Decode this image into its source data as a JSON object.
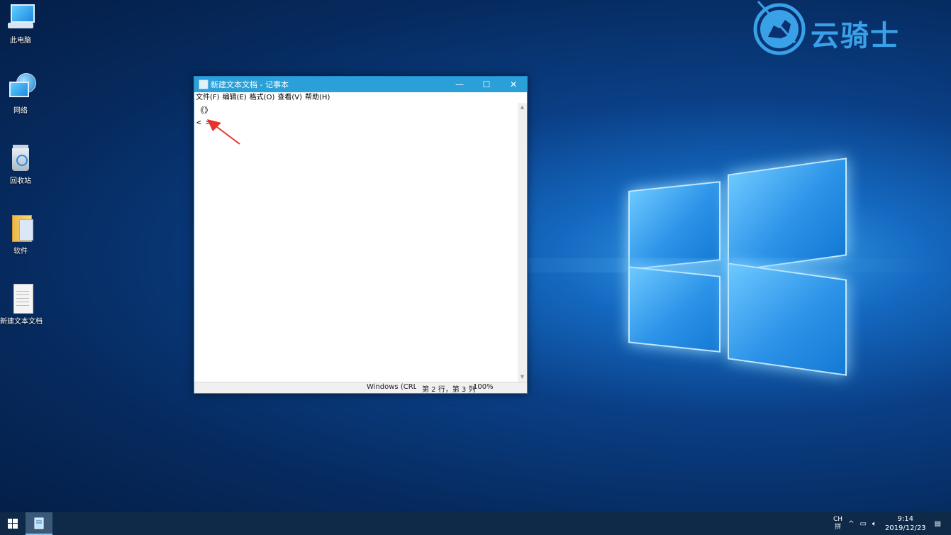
{
  "desktop": {
    "icons": [
      {
        "label": "此电脑",
        "icon": "computer-icon"
      },
      {
        "label": "网络",
        "icon": "network-icon"
      },
      {
        "label": "回收站",
        "icon": "recycle-bin-icon"
      },
      {
        "label": "软件",
        "icon": "folder-icon"
      },
      {
        "label": "新建文本文档",
        "icon": "text-file-icon"
      }
    ]
  },
  "brand": {
    "text": "云骑士",
    "color": "#3aa0e8"
  },
  "notepad": {
    "title": "新建文本文档 - 记事本",
    "controls": {
      "minimize": "—",
      "maximize": "☐",
      "close": "✕"
    },
    "menu": [
      "文件(F)",
      "编辑(E)",
      "格式(O)",
      "查看(V)",
      "帮助(H)"
    ],
    "lines": [
      "《》",
      "< >"
    ],
    "status": {
      "encoding": "Windows (CRLF",
      "position": "第 2 行，第 3 列",
      "zoom": "100%"
    }
  },
  "taskbar": {
    "ime_top": "CH",
    "ime_bottom": "拼",
    "time": "9:14",
    "date": "2019/12/23"
  },
  "colors": {
    "titlebar": "#2a9fd8",
    "taskbar": "#0f2a48",
    "annotation_arrow": "#e8332a"
  }
}
